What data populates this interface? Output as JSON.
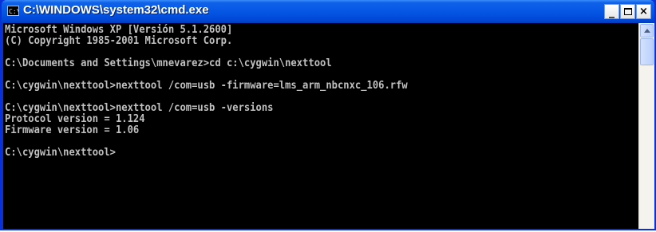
{
  "window": {
    "title": "C:\\WINDOWS\\system32\\cmd.exe",
    "icon": "cmd-icon",
    "controls": {
      "minimize": "_",
      "close": "×"
    }
  },
  "console": {
    "lines": [
      "Microsoft Windows XP [Versión 5.1.2600]",
      "(C) Copyright 1985-2001 Microsoft Corp.",
      "",
      "C:\\Documents and Settings\\mnevarez>cd c:\\cygwin\\nexttool",
      "",
      "C:\\cygwin\\nexttool>nexttool /com=usb -firmware=lms_arm_nbcnxc_106.rfw",
      "",
      "C:\\cygwin\\nexttool>nexttool /com=usb -versions",
      "Protocol version = 1.124",
      "Firmware version = 1.06",
      "",
      "C:\\cygwin\\nexttool>"
    ]
  },
  "colors": {
    "titlebar": "#0555e3",
    "console_bg": "#000000",
    "console_fg": "#c0c0c0"
  }
}
